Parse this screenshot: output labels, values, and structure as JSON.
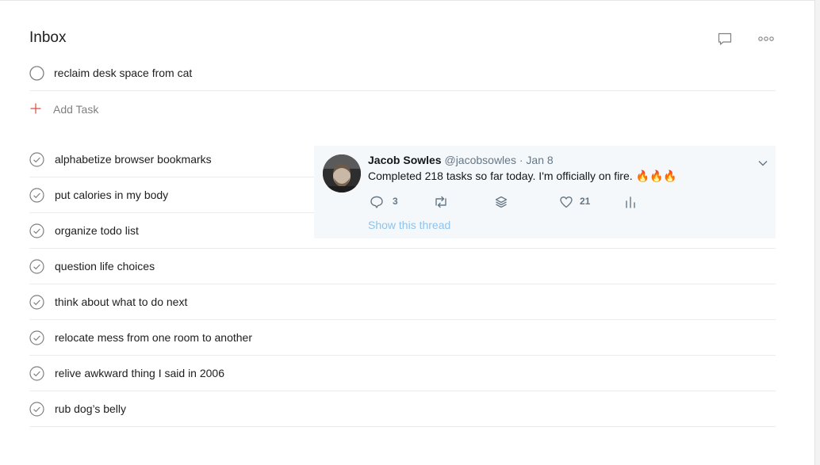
{
  "project": {
    "title": "Inbox"
  },
  "header_icons": {
    "comment": "comment-icon",
    "more": "more-options-icon"
  },
  "active_task": {
    "text": "reclaim desk space from cat"
  },
  "add_task": {
    "label": "Add Task"
  },
  "completed_tasks": [
    {
      "text": "alphabetize browser bookmarks"
    },
    {
      "text": "put calories in my body"
    },
    {
      "text": "organize todo list"
    },
    {
      "text": "question life choices"
    },
    {
      "text": "think about what to do next"
    },
    {
      "text": "relocate mess from one room to another"
    },
    {
      "text": "relive awkward thing I said in 2006"
    },
    {
      "text": "rub dog’s belly"
    }
  ],
  "tweet": {
    "name": "Jacob Sowles",
    "handle": "@jacobsowles",
    "separator": "·",
    "date": "Jan 8",
    "text": "Completed 218 tasks so far today. I'm officially on fire. 🔥🔥🔥",
    "reply_count": "3",
    "like_count": "21",
    "show_thread": "Show this thread"
  },
  "colors": {
    "accent": "#db4c3f",
    "tweet_bg": "#f5f8fa",
    "tweet_link": "#8ec3ec",
    "divider": "#ececec"
  }
}
